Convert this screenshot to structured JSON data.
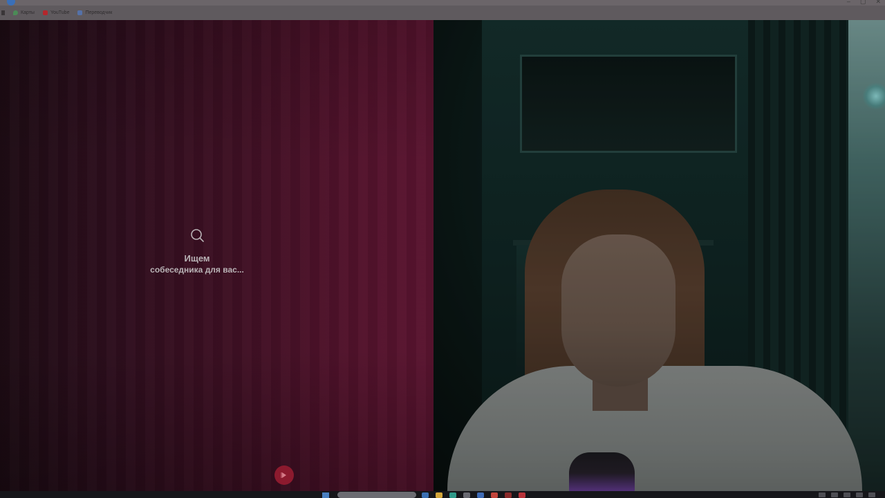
{
  "browser": {
    "bookmarks": [
      {
        "label": "Карты",
        "icon": "maps-pin-icon"
      },
      {
        "label": "YouTube",
        "icon": "youtube-icon"
      },
      {
        "label": "Переводчик",
        "icon": "translate-icon"
      }
    ]
  },
  "search_panel": {
    "title": "Ищем",
    "subtitle": "собеседника для вас..."
  },
  "next_button": {
    "icon": "next-arrow-icon"
  },
  "colors": {
    "left_panel": "#3f1024",
    "next_button": "#8c1a2e",
    "status_text": "#b9b3b6"
  }
}
